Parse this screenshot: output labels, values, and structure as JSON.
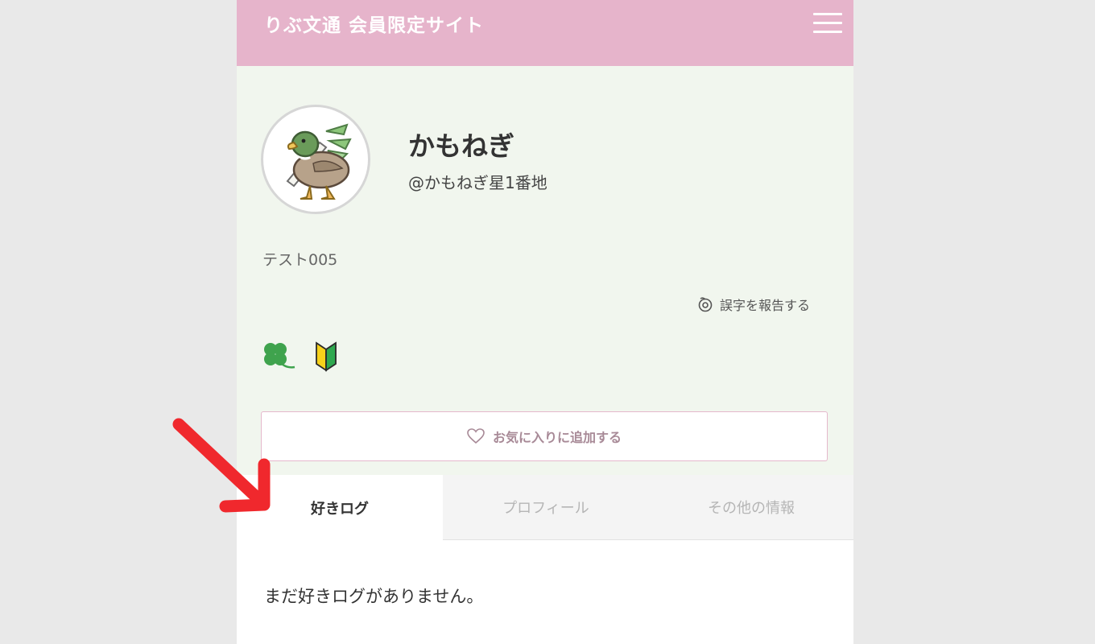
{
  "header": {
    "site_title": "りぶ文通 会員限定サイト",
    "menu_icon": "hamburger-menu-icon",
    "background_color": "#e6b4cb"
  },
  "profile": {
    "name": "かもねぎ",
    "handle": "@かもねぎ星1番地",
    "avatar_icon": "duck-with-leek-avatar",
    "bio": "テスト005"
  },
  "report": {
    "label": "誤字を報告する",
    "icon": "report-icon"
  },
  "badges": [
    {
      "icon": "four-leaf-clover-icon"
    },
    {
      "icon": "beginner-mark-icon"
    }
  ],
  "favorite_button": {
    "label": "お気に入りに追加する",
    "icon": "heart-outline-icon"
  },
  "tabs": [
    {
      "label": "好きログ",
      "active": true
    },
    {
      "label": "プロフィール",
      "active": false
    },
    {
      "label": "その他の情報",
      "active": false
    }
  ],
  "content": {
    "empty_message": "まだ好きログがありません。"
  },
  "annotation": {
    "arrow_icon": "red-arrow-icon",
    "arrow_color": "#f0282d"
  }
}
